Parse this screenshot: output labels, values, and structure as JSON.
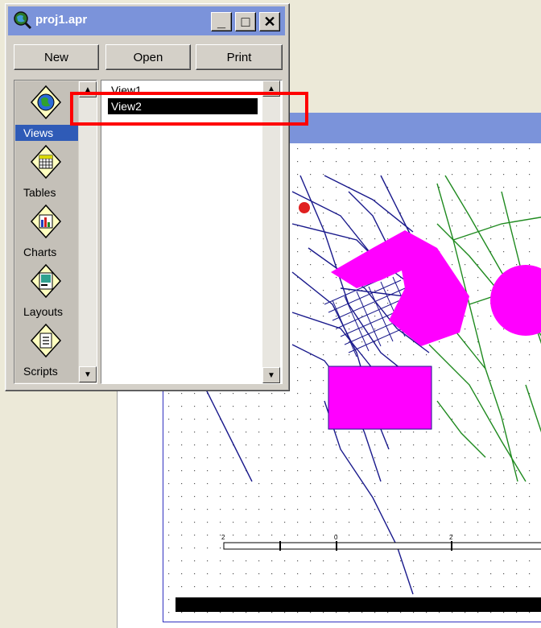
{
  "project_window": {
    "title": "proj1.apr",
    "title_buttons": {
      "minimize": "_",
      "maximize": "□",
      "close": "✕"
    },
    "toolbar": {
      "new_label": "New",
      "open_label": "Open",
      "print_label": "Print"
    },
    "doc_types": [
      {
        "label": "Views",
        "icon": "views-globe-icon",
        "selected": true
      },
      {
        "label": "Tables",
        "icon": "tables-grid-icon",
        "selected": false
      },
      {
        "label": "Charts",
        "icon": "charts-bar-icon",
        "selected": false
      },
      {
        "label": "Layouts",
        "icon": "layouts-page-icon",
        "selected": false
      },
      {
        "label": "Scripts",
        "icon": "scripts-page-icon",
        "selected": false
      }
    ],
    "documents": [
      {
        "label": "View1",
        "selected": false
      },
      {
        "label": "View2",
        "selected": true
      }
    ]
  },
  "layout_window": {
    "scale_bar_labels": [
      "2",
      "0",
      "2"
    ]
  },
  "colors": {
    "titlebar": "#7b93da",
    "window_face": "#d4d0c8",
    "selection": "#2f5bb7",
    "highlight_box": "#ff0000",
    "roads_blue": "#1a1a8c",
    "roads_green": "#1f8a1f",
    "polygon_magenta": "#ff00ff"
  }
}
